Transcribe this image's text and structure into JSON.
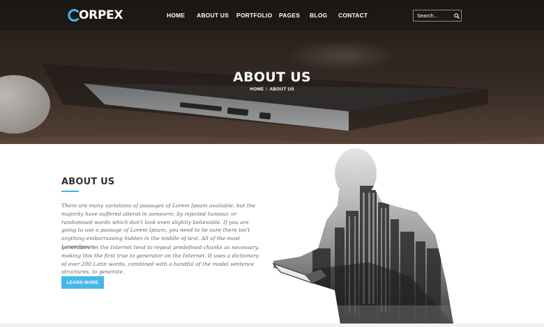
{
  "header": {
    "logo_text": "ORPEX",
    "nav": [
      "HOME",
      "ABOUT US",
      "PORTFOLIO",
      "PAGES",
      "BLOG",
      "CONTACT"
    ],
    "search_placeholder": "Search..."
  },
  "hero": {
    "title": "ABOUT US",
    "breadcrumb": {
      "home": "HOME",
      "separator": "/",
      "current": "ABOUT US"
    }
  },
  "about": {
    "heading": "ABOUT US",
    "paragraph_1": "There are many variations of passages of Lorem Ipsum available, but the majority have suffered alterat in someorm, by injected humour, or randomised words which don't look even slightly believable. If you are going to use a passage of Lorem Ipsum, you need to be sure there isn't anything embarrassing hidden in the middle of text. All of the most LoremIpsum.",
    "paragraph_2": "generators on the Internet tend to repeat predefined chunks as necessary, making this the first true to generator on the Internet. It uses a dictionary of over 200 Latin words, combined with a handful of the model sentence structures, to generate.",
    "button_label": "LEARN MORE"
  },
  "colors": {
    "accent": "#46b8e8",
    "heading": "#333333",
    "body_text": "#666666",
    "hero_bg": "#3b302b"
  },
  "icons": [
    "logo-c-icon",
    "search-icon"
  ]
}
